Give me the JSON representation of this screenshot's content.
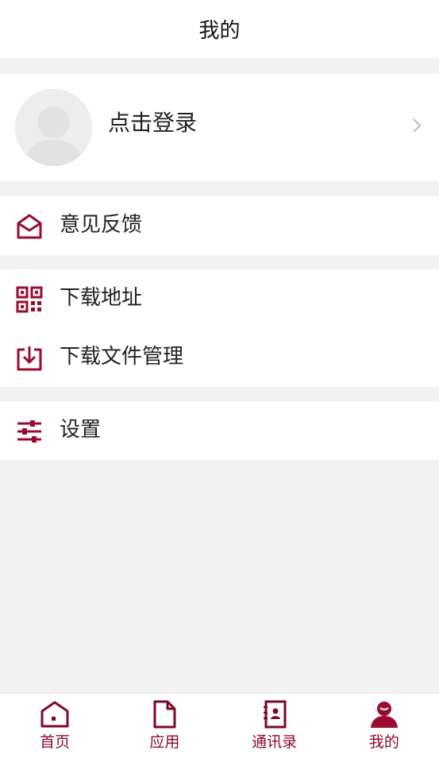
{
  "header": {
    "title": "我的"
  },
  "profile": {
    "login_label": "点击登录"
  },
  "menu_groups": [
    {
      "items": [
        {
          "label": "意见反馈",
          "icon": "feedback-envelope-icon"
        }
      ]
    },
    {
      "items": [
        {
          "label": "下载地址",
          "icon": "qr-code-icon"
        },
        {
          "label": "下载文件管理",
          "icon": "download-file-icon"
        }
      ]
    },
    {
      "items": [
        {
          "label": "设置",
          "icon": "settings-sliders-icon"
        }
      ]
    }
  ],
  "tabbar": {
    "tabs": [
      {
        "label": "首页",
        "icon": "home-icon",
        "active": false
      },
      {
        "label": "应用",
        "icon": "document-icon",
        "active": false
      },
      {
        "label": "通讯录",
        "icon": "contacts-book-icon",
        "active": false
      },
      {
        "label": "我的",
        "icon": "user-icon",
        "active": true
      }
    ]
  },
  "colors": {
    "accent": "#9b0b2f",
    "background": "#f2f2f2",
    "surface": "#ffffff",
    "text": "#222222",
    "chevron": "#bbbbbb"
  }
}
